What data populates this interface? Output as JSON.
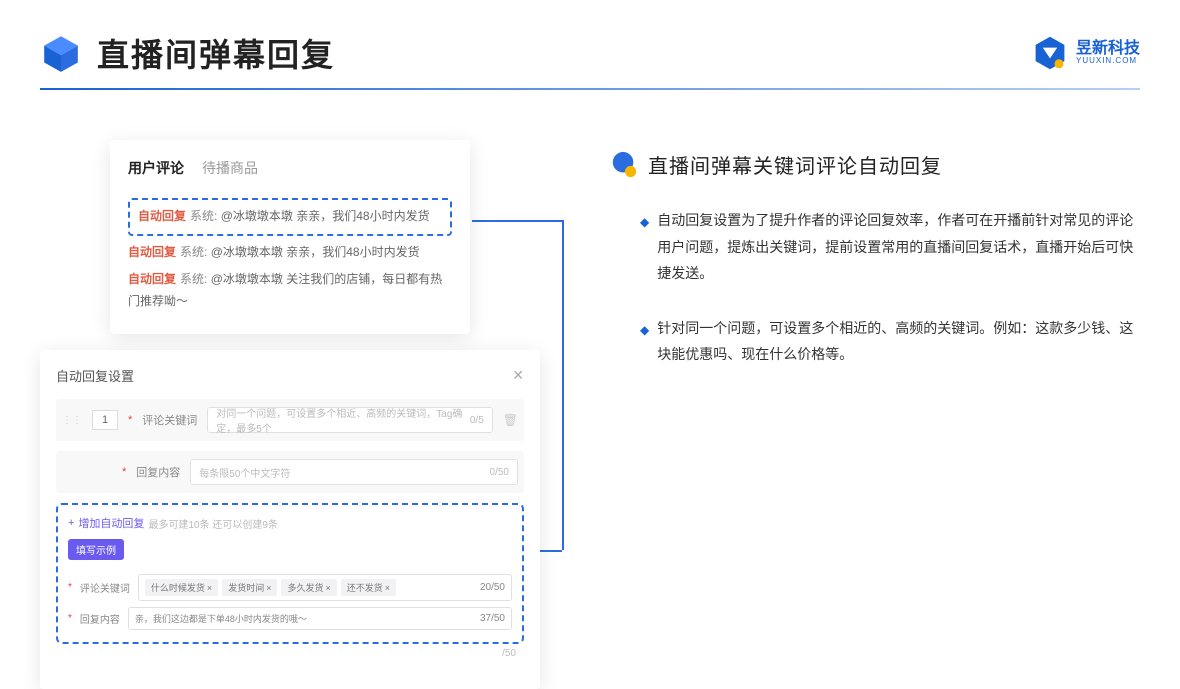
{
  "header": {
    "title": "直播间弹幕回复",
    "brand_cn": "昱新科技",
    "brand_en": "YUUXIN.COM"
  },
  "tabs": {
    "active": "用户评论",
    "inactive": "待播商品"
  },
  "comments": {
    "tag": "自动回复",
    "sys_prefix": "系统:",
    "c1": "@冰墩墩本墩 亲亲，我们48小时内发货",
    "c2": "@冰墩墩本墩 亲亲，我们48小时内发货",
    "c3": "@冰墩墩本墩 关注我们的店铺，每日都有热门推荐呦～"
  },
  "settings": {
    "title": "自动回复设置",
    "num": "1",
    "label_kw": "评论关键词",
    "placeholder_kw": "对同一个问题，可设置多个相近、高频的关键词，Tag确定，最多5个",
    "count_kw": "0/5",
    "label_content": "回复内容",
    "placeholder_content": "每条限50个中文字符",
    "count_content": "0/50",
    "add_text": "增加自动回复",
    "add_hint": "最多可建10条 还可以创建9条",
    "example_badge": "填写示例",
    "ex_kw_label": "评论关键词",
    "ex_tags": [
      "什么时候发货",
      "发货时间",
      "多久发货",
      "还不发货"
    ],
    "ex_kw_count": "20/50",
    "ex_content_label": "回复内容",
    "ex_content_text": "亲，我们这边都是下单48小时内发货的哦～",
    "ex_content_count": "37/50",
    "extra_count": "/50"
  },
  "right": {
    "title": "直播间弹幕关键词评论自动回复",
    "bullet1": "自动回复设置为了提升作者的评论回复效率，作者可在开播前针对常见的评论用户问题，提炼出关键词，提前设置常用的直播间回复话术，直播开始后可快捷发送。",
    "bullet2": "针对同一个问题，可设置多个相近的、高频的关键词。例如：这款多少钱、这块能优惠吗、现在什么价格等。"
  }
}
